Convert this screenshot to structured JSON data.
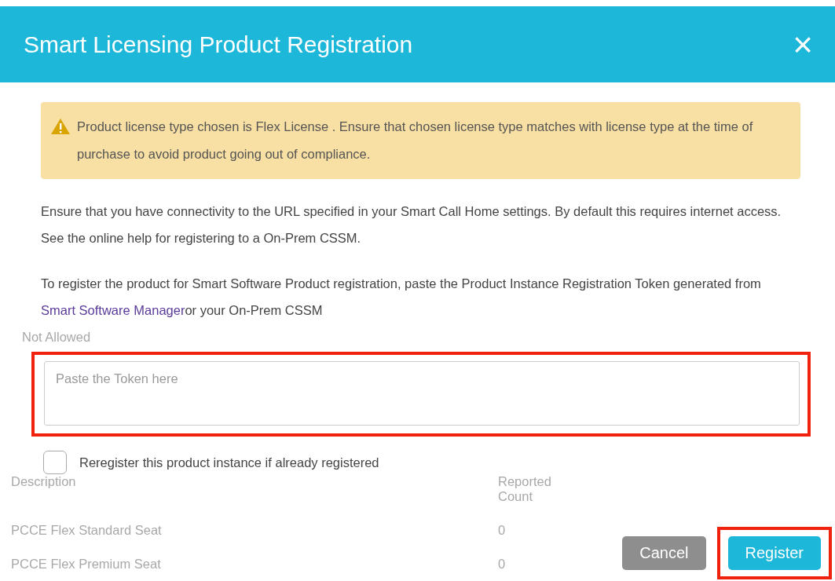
{
  "dialog": {
    "title": "Smart Licensing Product Registration",
    "close": "×",
    "warning": "Product license type chosen is Flex License . Ensure that chosen license type matches with license type at the time of purchase to avoid product going out of compliance.",
    "paragraphs": [
      {
        "text": "Ensure that you have connectivity to the URL specified in your Smart Call Home settings. By default this requires internet access. See the online help for registering to a On-Prem CSSM."
      },
      {
        "before": "To register the product for Smart Software Product registration, paste the Product Instance Registration Token generated from ",
        "link": "Smart Software Manager",
        "after": "or your On-Prem CSSM"
      }
    ],
    "token_field": {
      "placeholder": "Paste the Token here",
      "highlighted": true
    },
    "reregister": {
      "label": "Reregister this product instance if already registered",
      "checked": false
    },
    "buttons": [
      {
        "label": "Cancel",
        "kind": "secondary",
        "highlighted": false
      },
      {
        "label": "Register",
        "kind": "primary",
        "highlighted": true
      }
    ]
  },
  "background": {
    "status": "Not Allowed",
    "columns": [
      "Description",
      "Reported Count"
    ],
    "rows": [
      [
        "PCCE Flex Standard Seat",
        "0"
      ],
      [
        "PCCE Flex Premium Seat",
        "0"
      ]
    ]
  }
}
